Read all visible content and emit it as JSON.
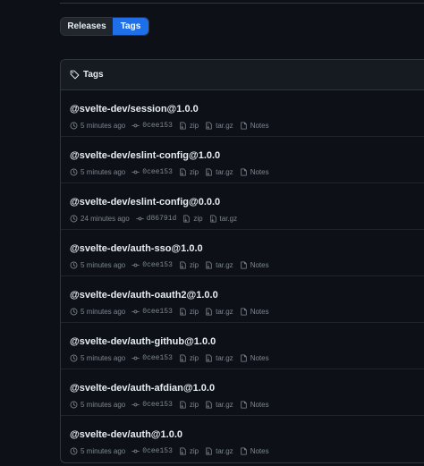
{
  "tabs": {
    "releases": "Releases",
    "tags": "Tags"
  },
  "panel": {
    "title": "Tags"
  },
  "tags": [
    {
      "name": "@svelte-dev/session@1.0.0",
      "time": "5 minutes ago",
      "commit": "0cee153",
      "zip": "zip",
      "tar": "tar.gz",
      "notes": "Notes"
    },
    {
      "name": "@svelte-dev/eslint-config@1.0.0",
      "time": "5 minutes ago",
      "commit": "0cee153",
      "zip": "zip",
      "tar": "tar.gz",
      "notes": "Notes"
    },
    {
      "name": "@svelte-dev/eslint-config@0.0.0",
      "time": "24 minutes ago",
      "commit": "d86791d",
      "zip": "zip",
      "tar": "tar.gz",
      "notes": ""
    },
    {
      "name": "@svelte-dev/auth-sso@1.0.0",
      "time": "5 minutes ago",
      "commit": "0cee153",
      "zip": "zip",
      "tar": "tar.gz",
      "notes": "Notes"
    },
    {
      "name": "@svelte-dev/auth-oauth2@1.0.0",
      "time": "5 minutes ago",
      "commit": "0cee153",
      "zip": "zip",
      "tar": "tar.gz",
      "notes": "Notes"
    },
    {
      "name": "@svelte-dev/auth-github@1.0.0",
      "time": "5 minutes ago",
      "commit": "0cee153",
      "zip": "zip",
      "tar": "tar.gz",
      "notes": "Notes"
    },
    {
      "name": "@svelte-dev/auth-afdian@1.0.0",
      "time": "5 minutes ago",
      "commit": "0cee153",
      "zip": "zip",
      "tar": "tar.gz",
      "notes": "Notes"
    },
    {
      "name": "@svelte-dev/auth@1.0.0",
      "time": "5 minutes ago",
      "commit": "0cee153",
      "zip": "zip",
      "tar": "tar.gz",
      "notes": "Notes"
    }
  ],
  "colors": {
    "accent": "#1f6feb",
    "background": "#0d1117",
    "muted": "#7d8590",
    "border": "#30363d"
  }
}
